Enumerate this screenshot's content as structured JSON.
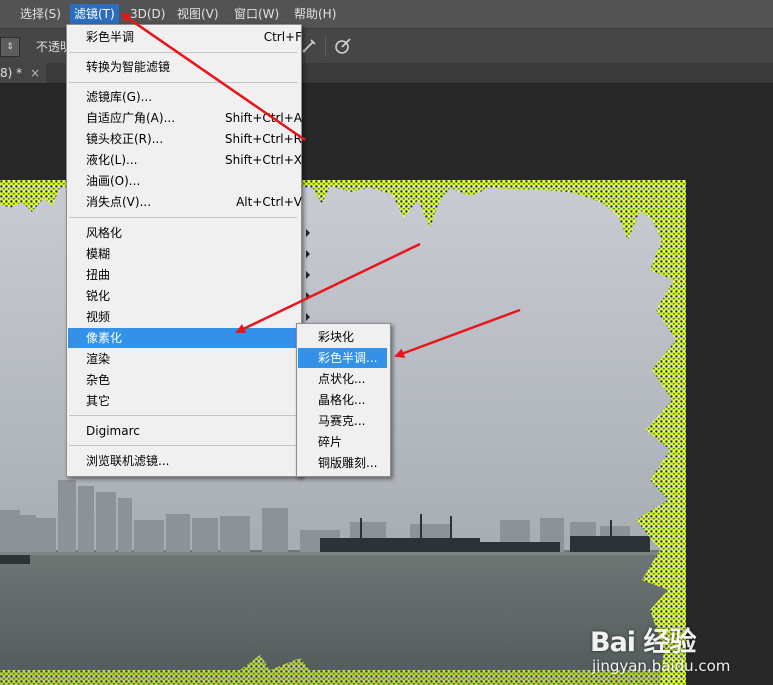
{
  "menubar": {
    "items": [
      "选择(S)",
      "滤镜(T)",
      "3D(D)",
      "视图(V)",
      "窗口(W)",
      "帮助(H)"
    ]
  },
  "options_bar": {
    "opacity_label": "不透明"
  },
  "document_tab": {
    "title": "8) *",
    "close": "×"
  },
  "filter_menu": {
    "last_filter": {
      "label": "彩色半调",
      "shortcut": "Ctrl+F"
    },
    "smart_filter": "转换为智能滤镜",
    "group1": [
      {
        "label": "滤镜库(G)...",
        "shortcut": ""
      },
      {
        "label": "自适应广角(A)...",
        "shortcut": "Shift+Ctrl+A"
      },
      {
        "label": "镜头校正(R)...",
        "shortcut": "Shift+Ctrl+R"
      },
      {
        "label": "液化(L)...",
        "shortcut": "Shift+Ctrl+X"
      },
      {
        "label": "油画(O)...",
        "shortcut": ""
      },
      {
        "label": "消失点(V)...",
        "shortcut": "Alt+Ctrl+V"
      }
    ],
    "group2": [
      "风格化",
      "模糊",
      "扭曲",
      "锐化",
      "视频",
      "像素化",
      "渲染",
      "杂色",
      "其它"
    ],
    "digimarc": "Digimarc",
    "browse": "浏览联机滤镜..."
  },
  "pixelate_submenu": [
    "彩块化",
    "彩色半调...",
    "点状化...",
    "晶格化...",
    "马赛克...",
    "碎片",
    "铜版雕刻..."
  ],
  "watermark": {
    "logo": "Bai 经验",
    "url": "jingyan.baidu.com"
  },
  "colors": {
    "highlight": "#3392e8",
    "menu_bg": "#f0f0f0",
    "arrow": "#e8151b",
    "menubar_bg": "#535353"
  }
}
